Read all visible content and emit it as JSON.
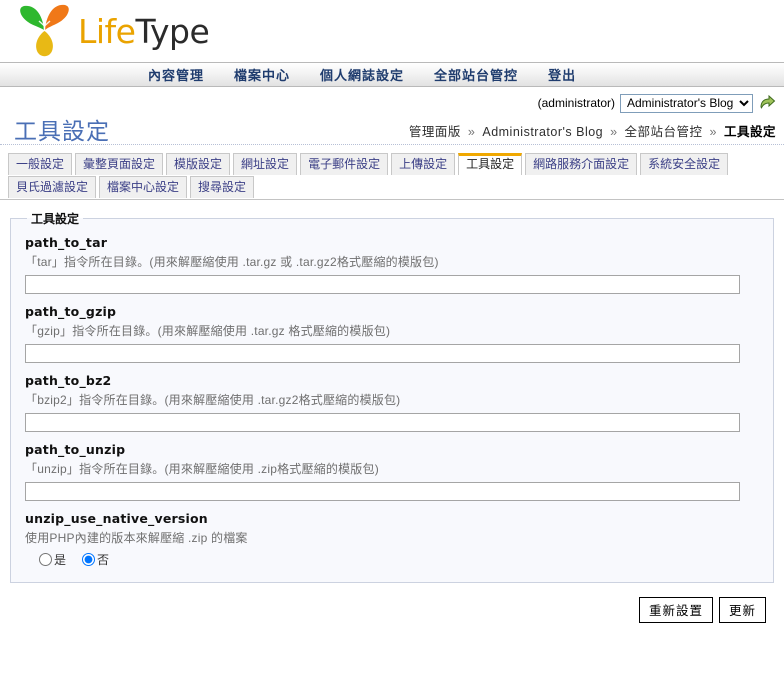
{
  "brand": {
    "name_life": "Life",
    "name_type": "Type",
    "logo_icon": "three-leaf-icon",
    "colors": {
      "life": "#eaa300",
      "type": "#2b2b2b",
      "leaf_green": "#2eb82e",
      "leaf_orange": "#f07818",
      "leaf_yellow": "#e8b915"
    }
  },
  "nav": {
    "items": [
      {
        "label": "內容管理"
      },
      {
        "label": "檔案中心"
      },
      {
        "label": "個人網誌設定"
      },
      {
        "label": "全部站台管控"
      },
      {
        "label": "登出"
      }
    ]
  },
  "blog_selector": {
    "username": "(administrator)",
    "selected_blog": "Administrator's Blog",
    "options": [
      "Administrator's Blog"
    ],
    "go_icon": "green-arrow-go-icon"
  },
  "page": {
    "title": "工具設定",
    "breadcrumb": [
      {
        "label": "管理面版",
        "current": false
      },
      {
        "label": "Administrator's Blog",
        "current": false
      },
      {
        "label": "全部站台管控",
        "current": false
      },
      {
        "label": "工具設定",
        "current": true
      }
    ],
    "breadcrumb_separator": "»"
  },
  "tabs": [
    {
      "label": "一般設定",
      "active": false
    },
    {
      "label": "彙整頁面設定",
      "active": false
    },
    {
      "label": "模版設定",
      "active": false
    },
    {
      "label": "網址設定",
      "active": false
    },
    {
      "label": "電子郵件設定",
      "active": false
    },
    {
      "label": "上傳設定",
      "active": false
    },
    {
      "label": "工具設定",
      "active": true
    },
    {
      "label": "網路服務介面設定",
      "active": false
    },
    {
      "label": "系統安全設定",
      "active": false
    },
    {
      "label": "貝氏過濾設定",
      "active": false
    },
    {
      "label": "檔案中心設定",
      "active": false
    },
    {
      "label": "搜尋設定",
      "active": false
    }
  ],
  "form": {
    "legend": "工具設定",
    "fields": [
      {
        "name": "path_to_tar",
        "desc": "「tar」指令所在目錄。(用來解壓縮使用 .tar.gz 或 .tar.gz2格式壓縮的模版包)",
        "value": "",
        "type": "text"
      },
      {
        "name": "path_to_gzip",
        "desc": "「gzip」指令所在目錄。(用來解壓縮使用 .tar.gz 格式壓縮的模版包)",
        "value": "",
        "type": "text"
      },
      {
        "name": "path_to_bz2",
        "desc": "「bzip2」指令所在目錄。(用來解壓縮使用 .tar.gz2格式壓縮的模版包)",
        "value": "",
        "type": "text"
      },
      {
        "name": "path_to_unzip",
        "desc": "「unzip」指令所在目錄。(用來解壓縮使用 .zip格式壓縮的模版包)",
        "value": "",
        "type": "text"
      },
      {
        "name": "unzip_use_native_version",
        "desc": "使用PHP內建的版本來解壓縮 .zip 的檔案",
        "type": "radio",
        "options": [
          {
            "label": "是",
            "checked": false
          },
          {
            "label": "否",
            "checked": true
          }
        ]
      }
    ]
  },
  "footer": {
    "reset_label": "重新設置",
    "update_label": "更新"
  }
}
